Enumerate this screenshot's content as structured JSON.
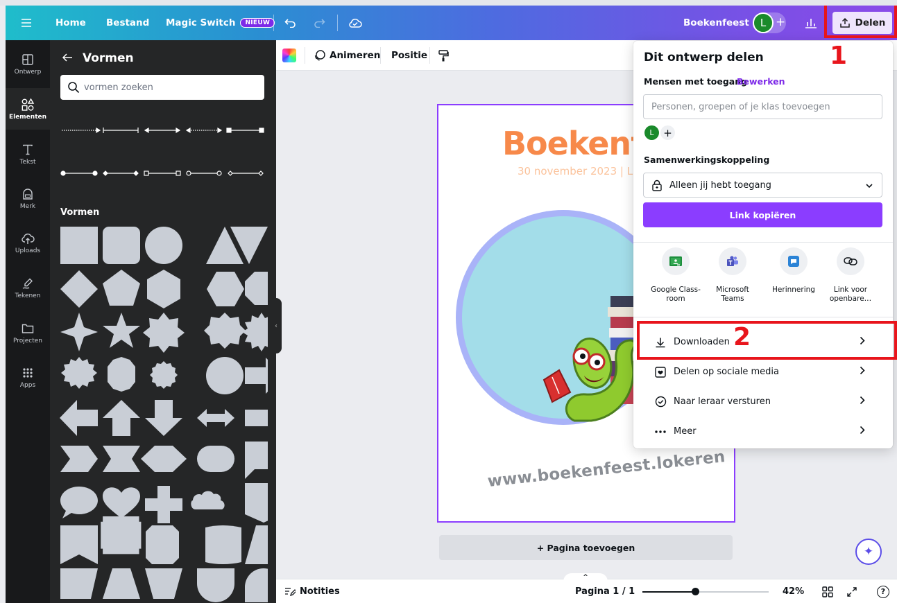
{
  "topbar": {
    "menu_icon": "hamburger-icon",
    "home": "Home",
    "file": "Bestand",
    "magic_switch": "Magic Switch",
    "new_badge": "NIEUW",
    "doc_name": "Boekenfeest",
    "avatar": "L",
    "share": "Delen"
  },
  "sidebar": {
    "items": [
      {
        "label": "Ontwerp",
        "icon": "layout-icon"
      },
      {
        "label": "Elementen",
        "icon": "shapes-icon"
      },
      {
        "label": "Tekst",
        "icon": "text-icon"
      },
      {
        "label": "Merk",
        "icon": "brand-icon"
      },
      {
        "label": "Uploads",
        "icon": "cloud-upload-icon"
      },
      {
        "label": "Tekenen",
        "icon": "draw-icon"
      },
      {
        "label": "Projecten",
        "icon": "folder-icon"
      },
      {
        "label": "Apps",
        "icon": "apps-grid-icon"
      }
    ]
  },
  "panel": {
    "title": "Vormen",
    "search_placeholder": "vormen zoeken",
    "section": "Vormen"
  },
  "toolbar": {
    "animate": "Animeren",
    "position": "Positie"
  },
  "document": {
    "title": "Boekenf",
    "date": "30 november 2023 | L",
    "url": "www.boekenfeest.lokeren"
  },
  "canvas": {
    "add_page": "+ Pagina toevoegen"
  },
  "bottombar": {
    "notes": "Notities",
    "page": "Pagina 1 / 1",
    "zoom": "42%",
    "zoom_level": 0.42
  },
  "share": {
    "title": "Dit ontwerp delen",
    "people_label": "Mensen met toegang",
    "edit": "Bewerken",
    "people_placeholder": "Personen, groepen of je klas toevoegen",
    "avatar": "L",
    "link_label": "Samenwerkingskoppeling",
    "access": "Alleen jij hebt toegang",
    "copy": "Link kopiëren",
    "apps": [
      {
        "label": "Google Class-\nroom",
        "icon": "google-classroom-icon"
      },
      {
        "label": "Microsoft\nTeams",
        "icon": "microsoft-teams-icon"
      },
      {
        "label": "Herinnering",
        "icon": "reminder-icon"
      },
      {
        "label": "Link voor\nopenbare…",
        "icon": "public-link-icon"
      }
    ],
    "actions": [
      {
        "label": "Downloaden",
        "icon": "download-icon"
      },
      {
        "label": "Delen op sociale media",
        "icon": "heart-icon"
      },
      {
        "label": "Naar leraar versturen",
        "icon": "check-circle-icon"
      },
      {
        "label": "Meer",
        "icon": "more-icon"
      }
    ]
  },
  "annotations": {
    "one": "1",
    "two": "2",
    "color": "#e8151c"
  }
}
